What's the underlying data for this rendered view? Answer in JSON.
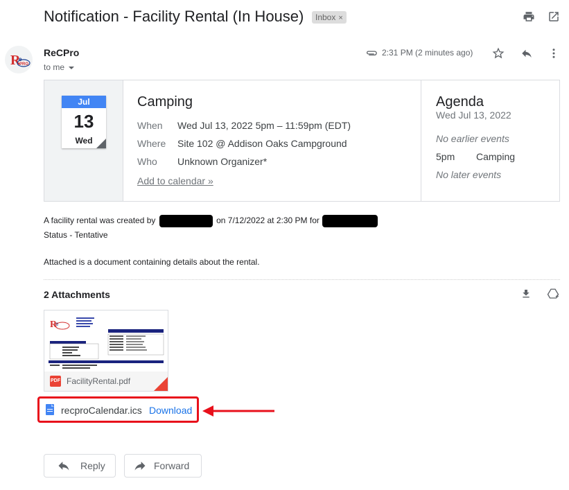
{
  "subject": "Notification - Facility Rental (In House)",
  "label_chip": "Inbox",
  "label_chip_close": "×",
  "sender": {
    "name": "ReCPro",
    "to": "to me",
    "time": "2:31 PM (2 minutes ago)"
  },
  "invite": {
    "month": "Jul",
    "day": "13",
    "weekday": "Wed",
    "title": "Camping",
    "rows": [
      {
        "label": "When",
        "value": "Wed Jul 13, 2022 5pm – 11:59pm (EDT)"
      },
      {
        "label": "Where",
        "value": "Site 102 @ Addison Oaks Campground"
      },
      {
        "label": "Who",
        "value": "Unknown Organizer*"
      }
    ],
    "add_to_calendar": "Add to calendar »"
  },
  "agenda": {
    "title": "Agenda",
    "date": "Wed Jul 13, 2022",
    "no_earlier": "No earlier events",
    "event_time": "5pm",
    "event_name": "Camping",
    "no_later": "No later events"
  },
  "body": {
    "line1_a": "A facility rental was created by",
    "line1_b": "on 7/12/2022 at 2:30 PM for",
    "line2": "Status - Tentative",
    "line3": "Attached is a document containing details about the rental."
  },
  "attachments": {
    "count_label": "2 Attachments",
    "pdf_name": "FacilityRental.pdf",
    "pdf_badge": "PDF",
    "ics_name": "recproCalendar.ics",
    "ics_action": "Download"
  },
  "actions": {
    "reply": "Reply",
    "forward": "Forward"
  },
  "colors": {
    "accent_blue": "#1a73e8",
    "calendar_blue": "#4285f4",
    "highlight_red": "#e8101b",
    "pdf_red": "#ea4335"
  }
}
